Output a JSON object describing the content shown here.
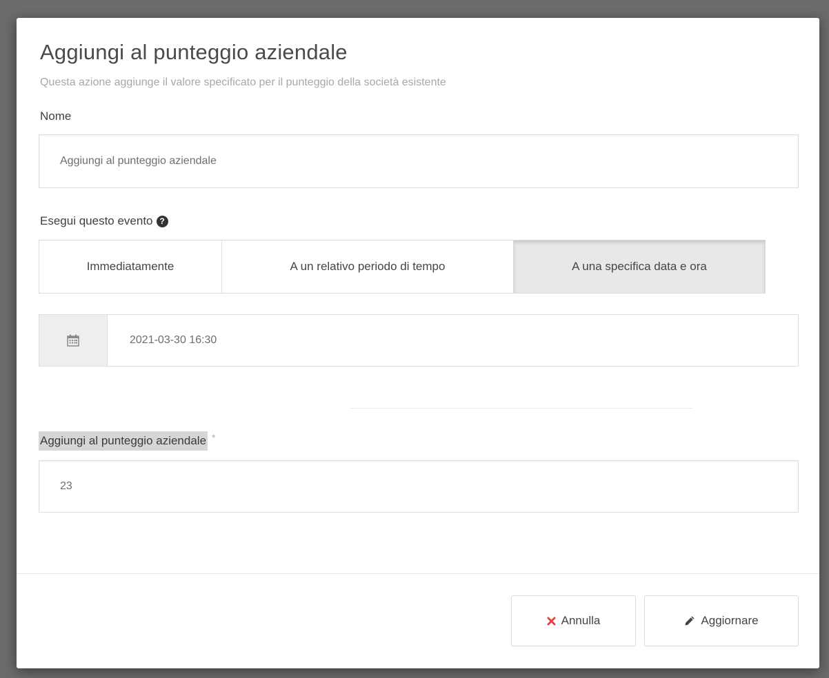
{
  "modal": {
    "title": "Aggiungi al punteggio aziendale",
    "subtitle": "Questa azione aggiunge il valore specificato per il punteggio della società esistente"
  },
  "name_field": {
    "label": "Nome",
    "value": "Aggiungi al punteggio aziendale"
  },
  "schedule": {
    "label": "Esegui questo evento",
    "help_icon": "question-circle-icon",
    "options": [
      {
        "label": "Immediatamente",
        "active": false
      },
      {
        "label": "A un relativo periodo di tempo",
        "active": false
      },
      {
        "label": "A una specifica data e ora",
        "active": true
      }
    ],
    "date_icon": "calendar-icon",
    "datetime_value": "2021-03-30 16:30"
  },
  "score_field": {
    "label": "Aggiungi al punteggio aziendale",
    "required_marker": "*",
    "value": "23"
  },
  "footer": {
    "cancel_label": "Annulla",
    "cancel_icon": "close-icon",
    "cancel_icon_color": "#e0424b",
    "submit_label": "Aggiornare",
    "submit_icon": "pencil-icon"
  }
}
